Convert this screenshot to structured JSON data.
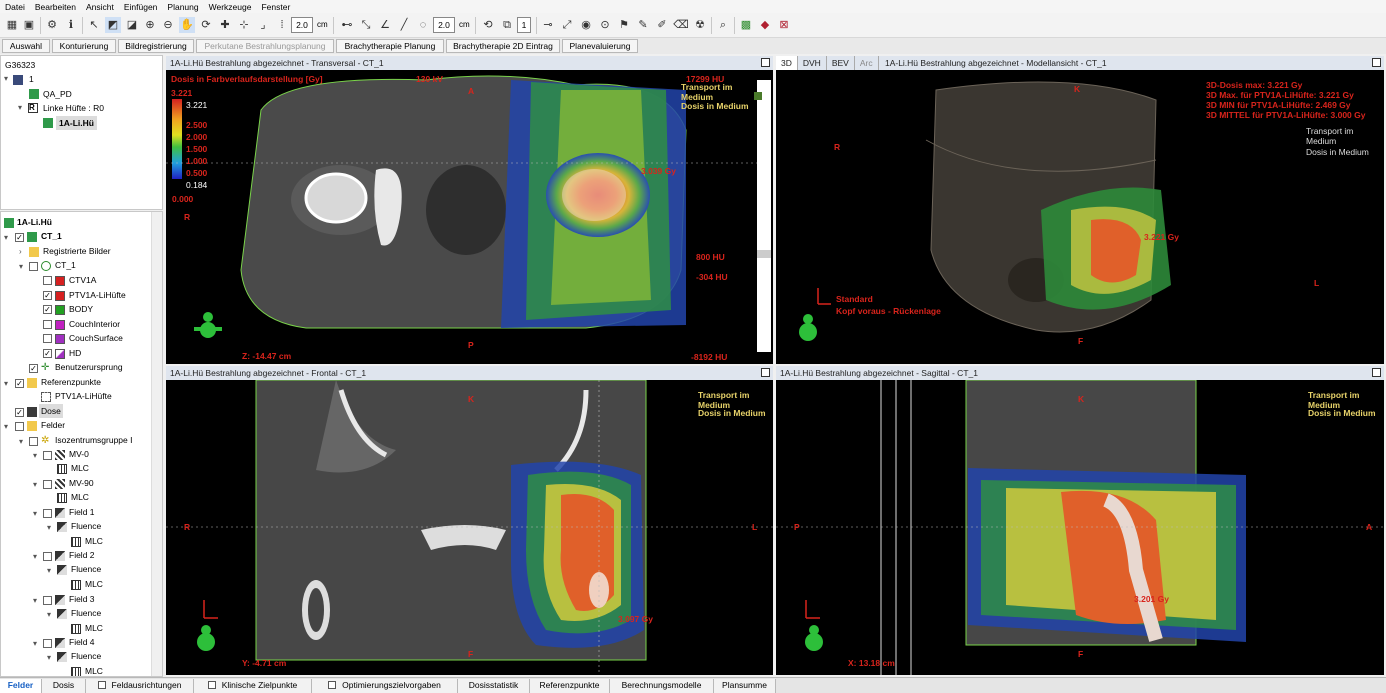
{
  "menu": [
    "Datei",
    "Bearbeiten",
    "Ansicht",
    "Einfügen",
    "Planung",
    "Werkzeuge",
    "Fenster"
  ],
  "toolbar": {
    "value1": "2.0",
    "unit1": "cm",
    "value2": "2.0",
    "unit2": "cm",
    "value3": "1"
  },
  "task_tabs": [
    "Auswahl",
    "Konturierung",
    "Bildregistrierung",
    "Perkutane Bestrahlungsplanung",
    "Brachytherapie Planung",
    "Brachytherapie 2D Eintrag",
    "Planevaluierung"
  ],
  "patient_tree": {
    "root": "G36323",
    "n1": "1",
    "n2": "QA_PD",
    "n3": "Linke Hüfte : R0",
    "n4": "1A-Li.Hü"
  },
  "structure_tree": {
    "plan": "1A-Li.Hü",
    "ct": "CT_1",
    "reg": "Registrierte Bilder",
    "ct_sub": "CT_1",
    "structures": [
      "CTV1A",
      "PTV1A-LiHüfte",
      "BODY",
      "CouchInterior",
      "CouchSurface",
      "HD"
    ],
    "structure_colors": [
      "#d62020",
      "#d62020",
      "#22a022",
      "#c020c0",
      "#a030c0",
      "#a030c0"
    ],
    "user_origin": "Benutzerursprung",
    "ref_points": "Referenzpunkte",
    "ref_point_1": "PTV1A-LiHüfte",
    "dose": "Dose",
    "fields": "Felder",
    "iso_group": "Isozentrumsgruppe I",
    "mv0": "MV-0",
    "mv90": "MV-90",
    "mlc": "MLC",
    "field1": "Field 1",
    "field2": "Field 2",
    "field3": "Field 3",
    "field4": "Field 4",
    "fluence": "Fluence"
  },
  "transversal": {
    "title": "1A-Li.Hü  Bestrahlung abgezeichnet - Transversal - CT_1",
    "dose_title": "Dosis in Farbverlaufsdarstellung [Gy]",
    "kv": "130 kV",
    "hu_top": "17299 HU",
    "transport": "Transport im Medium",
    "dosis_medium": "Dosis in Medium",
    "legend_max": "3.221",
    "legend_vals": [
      "2.500",
      "2.000",
      "1.500",
      "1.000",
      "0.500"
    ],
    "legend_min": "0.184",
    "legend_zero": "0.000",
    "dir_top": "A",
    "dir_bottom": "P",
    "dir_left": "R",
    "dose_point": "3.039 Gy",
    "hu_800": "800 HU",
    "hu_m304": "-304 HU",
    "hu_m8192": "-8192 HU",
    "z": "Z: -14.47 cm"
  },
  "model": {
    "tabs": [
      "3D",
      "DVH",
      "BEV",
      "Arc"
    ],
    "title": "1A-Li.Hü  Bestrahlung abgezeichnet - Modellansicht - CT_1",
    "stats": [
      "3D-Dosis max: 3.221 Gy",
      "3D Max. für PTV1A-LiHüfte: 3.221 Gy",
      "3D MIN für PTV1A-LiHüfte: 2.469 Gy",
      "3D MITTEL für PTV1A-LiHüfte: 3.000 Gy"
    ],
    "transport": "Transport im Medium",
    "dosis_medium": "Dosis in Medium",
    "dir_k": "K",
    "dir_r": "R",
    "dir_l": "L",
    "dir_f": "F",
    "dose_point": "3.221 Gy",
    "standard": "Standard",
    "orientation": "Kopf voraus - Rückenlage"
  },
  "frontal": {
    "title": "1A-Li.Hü  Bestrahlung abgezeichnet - Frontal - CT_1",
    "transport": "Transport im Medium",
    "dosis_medium": "Dosis in Medium",
    "dir_k": "K",
    "dir_r": "R",
    "dir_l": "L",
    "dir_f": "F",
    "dose_point": "3.097 Gy",
    "y": "Y: -4.71 cm"
  },
  "sagittal": {
    "title": "1A-Li.Hü  Bestrahlung abgezeichnet - Sagittal - CT_1",
    "transport": "Transport im Medium",
    "dosis_medium": "Dosis in Medium",
    "dir_k": "K",
    "dir_p": "P",
    "dir_a": "A",
    "dir_f": "F",
    "dose_point": "3.201 Gy",
    "x": "X: 13.18 cm"
  },
  "bottom_tabs": [
    "Felder",
    "Dosis",
    "Feldausrichtungen",
    "Klinische Zielpunkte",
    "Optimierungszielvorgaben",
    "Dosisstatistik",
    "Referenzpunkte",
    "Berechnungsmodelle",
    "Plansumme"
  ]
}
